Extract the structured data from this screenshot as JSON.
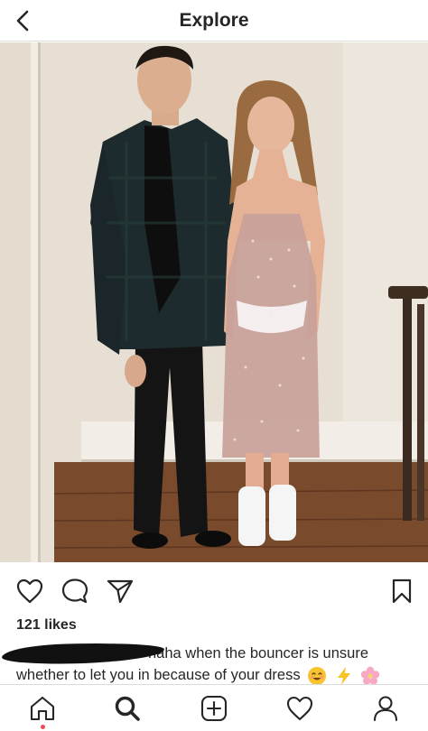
{
  "header": {
    "title": "Explore"
  },
  "post": {
    "likes": "121 likes",
    "caption_line1": "haha when the bouncer is unsure",
    "caption_line2": "whether to let you in because of your dress"
  },
  "icons": {
    "back": "chevron-left-icon",
    "like": "heart-icon",
    "comment": "comment-bubble-icon",
    "share": "paper-plane-icon",
    "save": "bookmark-icon",
    "home": "home-icon",
    "search": "search-icon",
    "new_post": "plus-square-icon",
    "activity": "heart-icon",
    "profile": "person-icon"
  },
  "caption_emojis": [
    "smiling-face-icon",
    "lightning-icon",
    "cherry-blossom-icon"
  ],
  "colors": {
    "notification_dot": "#ed4956",
    "text": "#262626",
    "divider": "#dbdbdb"
  }
}
